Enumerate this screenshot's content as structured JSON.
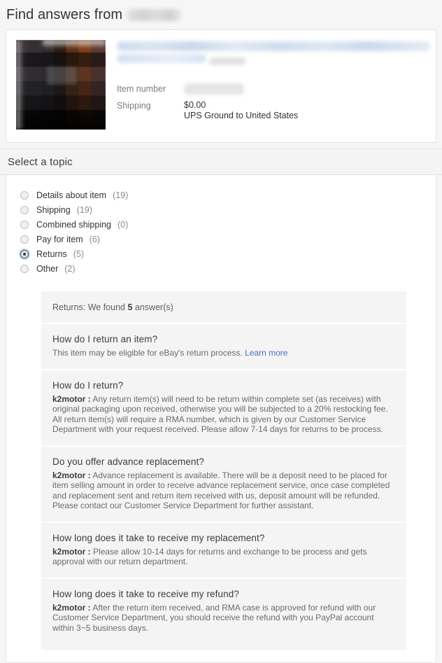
{
  "header": {
    "title_prefix": "Find answers from",
    "seller_name_redacted": true
  },
  "item_card": {
    "thumbnail_alt": "item-thumbnail",
    "title_redacted": true,
    "fields": [
      {
        "label": "Item number",
        "value": "",
        "redacted": true
      },
      {
        "label": "Shipping",
        "value": "$0.00",
        "value_sub": "UPS Ground to United States",
        "redacted": false
      }
    ]
  },
  "topic_section": {
    "title": "Select a topic",
    "options": [
      {
        "label": "Details about item",
        "count": "(19)",
        "selected": false
      },
      {
        "label": "Shipping",
        "count": "(19)",
        "selected": false
      },
      {
        "label": "Combined shipping",
        "count": "(0)",
        "selected": false
      },
      {
        "label": "Pay for item",
        "count": "(6)",
        "selected": false
      },
      {
        "label": "Returns",
        "count": "(5)",
        "selected": true
      },
      {
        "label": "Other",
        "count": "(2)",
        "selected": false
      }
    ]
  },
  "answers": {
    "summary_prefix": "Returns: We found ",
    "summary_count": "5",
    "summary_suffix": " answer(s)",
    "items": [
      {
        "question": "How do I return an item?",
        "seller": "",
        "answer": "This item may be eligible for eBay's return process. ",
        "link_text": "Learn more"
      },
      {
        "question": "How do I return?",
        "seller": "k2motor :",
        "answer": "Any return item(s) will need to be return within complete set (as receives) with original packaging upon received, otherwise you will be subjected to a 20% restocking fee. All return item(s) will require a RMA number, which is given by our Customer Service Department with your request received. Please allow 7-14 days for returns to be process.",
        "link_text": ""
      },
      {
        "question": "Do you offer advance replacement?",
        "seller": "k2motor :",
        "answer": "Advance replacement is available. There will be a deposit need to be placed for item selling amount in order to receive advance replacement service, once case completed and replacement sent and return item received with us, deposit amount will be refunded. Please contact our Customer Service Department for further assistant.",
        "link_text": ""
      },
      {
        "question": "How long does it take to receive my replacement?",
        "seller": "k2motor :",
        "answer": "Please allow 10-14 days for returns and exchange to be process and gets approval with our return department.",
        "link_text": ""
      },
      {
        "question": "How long does it take to receive my refund?",
        "seller": "k2motor :",
        "answer": "After the return item received, and RMA case is approved for refund with our Customer Service Department, you should receive the refund with you PayPal account within 3~5 business days.",
        "link_text": ""
      }
    ]
  },
  "colors": {
    "page_background": "#f6f6f6",
    "card_background": "#ffffff",
    "panel_background": "#f4f4f4",
    "link": "#4a72b8",
    "radio_focus_ring": "#b9d4f0",
    "muted_text": "#8a8a8a"
  }
}
